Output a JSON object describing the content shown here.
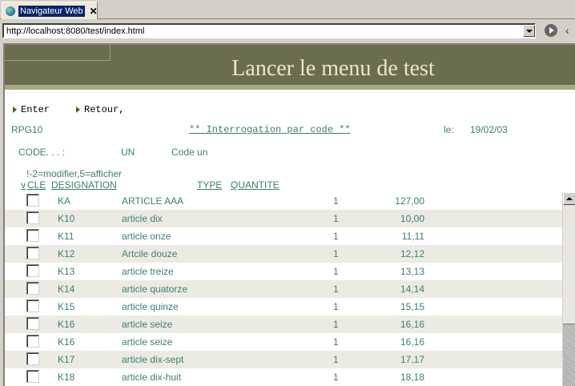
{
  "browser": {
    "tab_title": "Navigateur Web",
    "tab_close": "✕",
    "url": "http://localhost:8080/test/index.html"
  },
  "page": {
    "banner_title": "Lancer le menu de test",
    "fkeys": [
      {
        "label": "Enter"
      },
      {
        "label": "Retour,"
      }
    ],
    "program": "RPG10",
    "screen_title": "** Interrogation par code **",
    "date_label": "le:",
    "date_value": "19/02/03",
    "code_label": "CODE. . . :",
    "code_value": "UN",
    "code_desc": "Code un",
    "options_hint": "!-2=modifier,5=afficher",
    "columns": {
      "v": "v",
      "cle": "CLE",
      "designation": "DESIGNATION",
      "type": "TYPE",
      "quantite": "QUANTITE"
    },
    "rows": [
      {
        "cle": "KA",
        "designation": "ARTICLE AAA",
        "type": "1",
        "quantite": "127,00"
      },
      {
        "cle": "K10",
        "designation": "article dix",
        "type": "1",
        "quantite": "10,00"
      },
      {
        "cle": "K11",
        "designation": "article onze",
        "type": "1",
        "quantite": "11,11"
      },
      {
        "cle": "K12",
        "designation": "Artcile douze",
        "type": "1",
        "quantite": "12,12"
      },
      {
        "cle": "K13",
        "designation": "article treize",
        "type": "1",
        "quantite": "13,13"
      },
      {
        "cle": "K14",
        "designation": "article quatorze",
        "type": "1",
        "quantite": "14,14"
      },
      {
        "cle": "K15",
        "designation": "article quinze",
        "type": "1",
        "quantite": "15,15"
      },
      {
        "cle": "K16",
        "designation": "article seize",
        "type": "1",
        "quantite": "16,16"
      },
      {
        "cle": "K16",
        "designation": "article seize",
        "type": "1",
        "quantite": "16,16"
      },
      {
        "cle": "K17",
        "designation": "article dix-sept",
        "type": "1",
        "quantite": "17,17"
      },
      {
        "cle": "K18",
        "designation": "article dix-huit",
        "type": "1",
        "quantite": "18,18"
      }
    ]
  },
  "colors": {
    "banner": "#6b6e4e",
    "text_green": "#3f7f6f",
    "row_alt": "#ebebe3"
  }
}
